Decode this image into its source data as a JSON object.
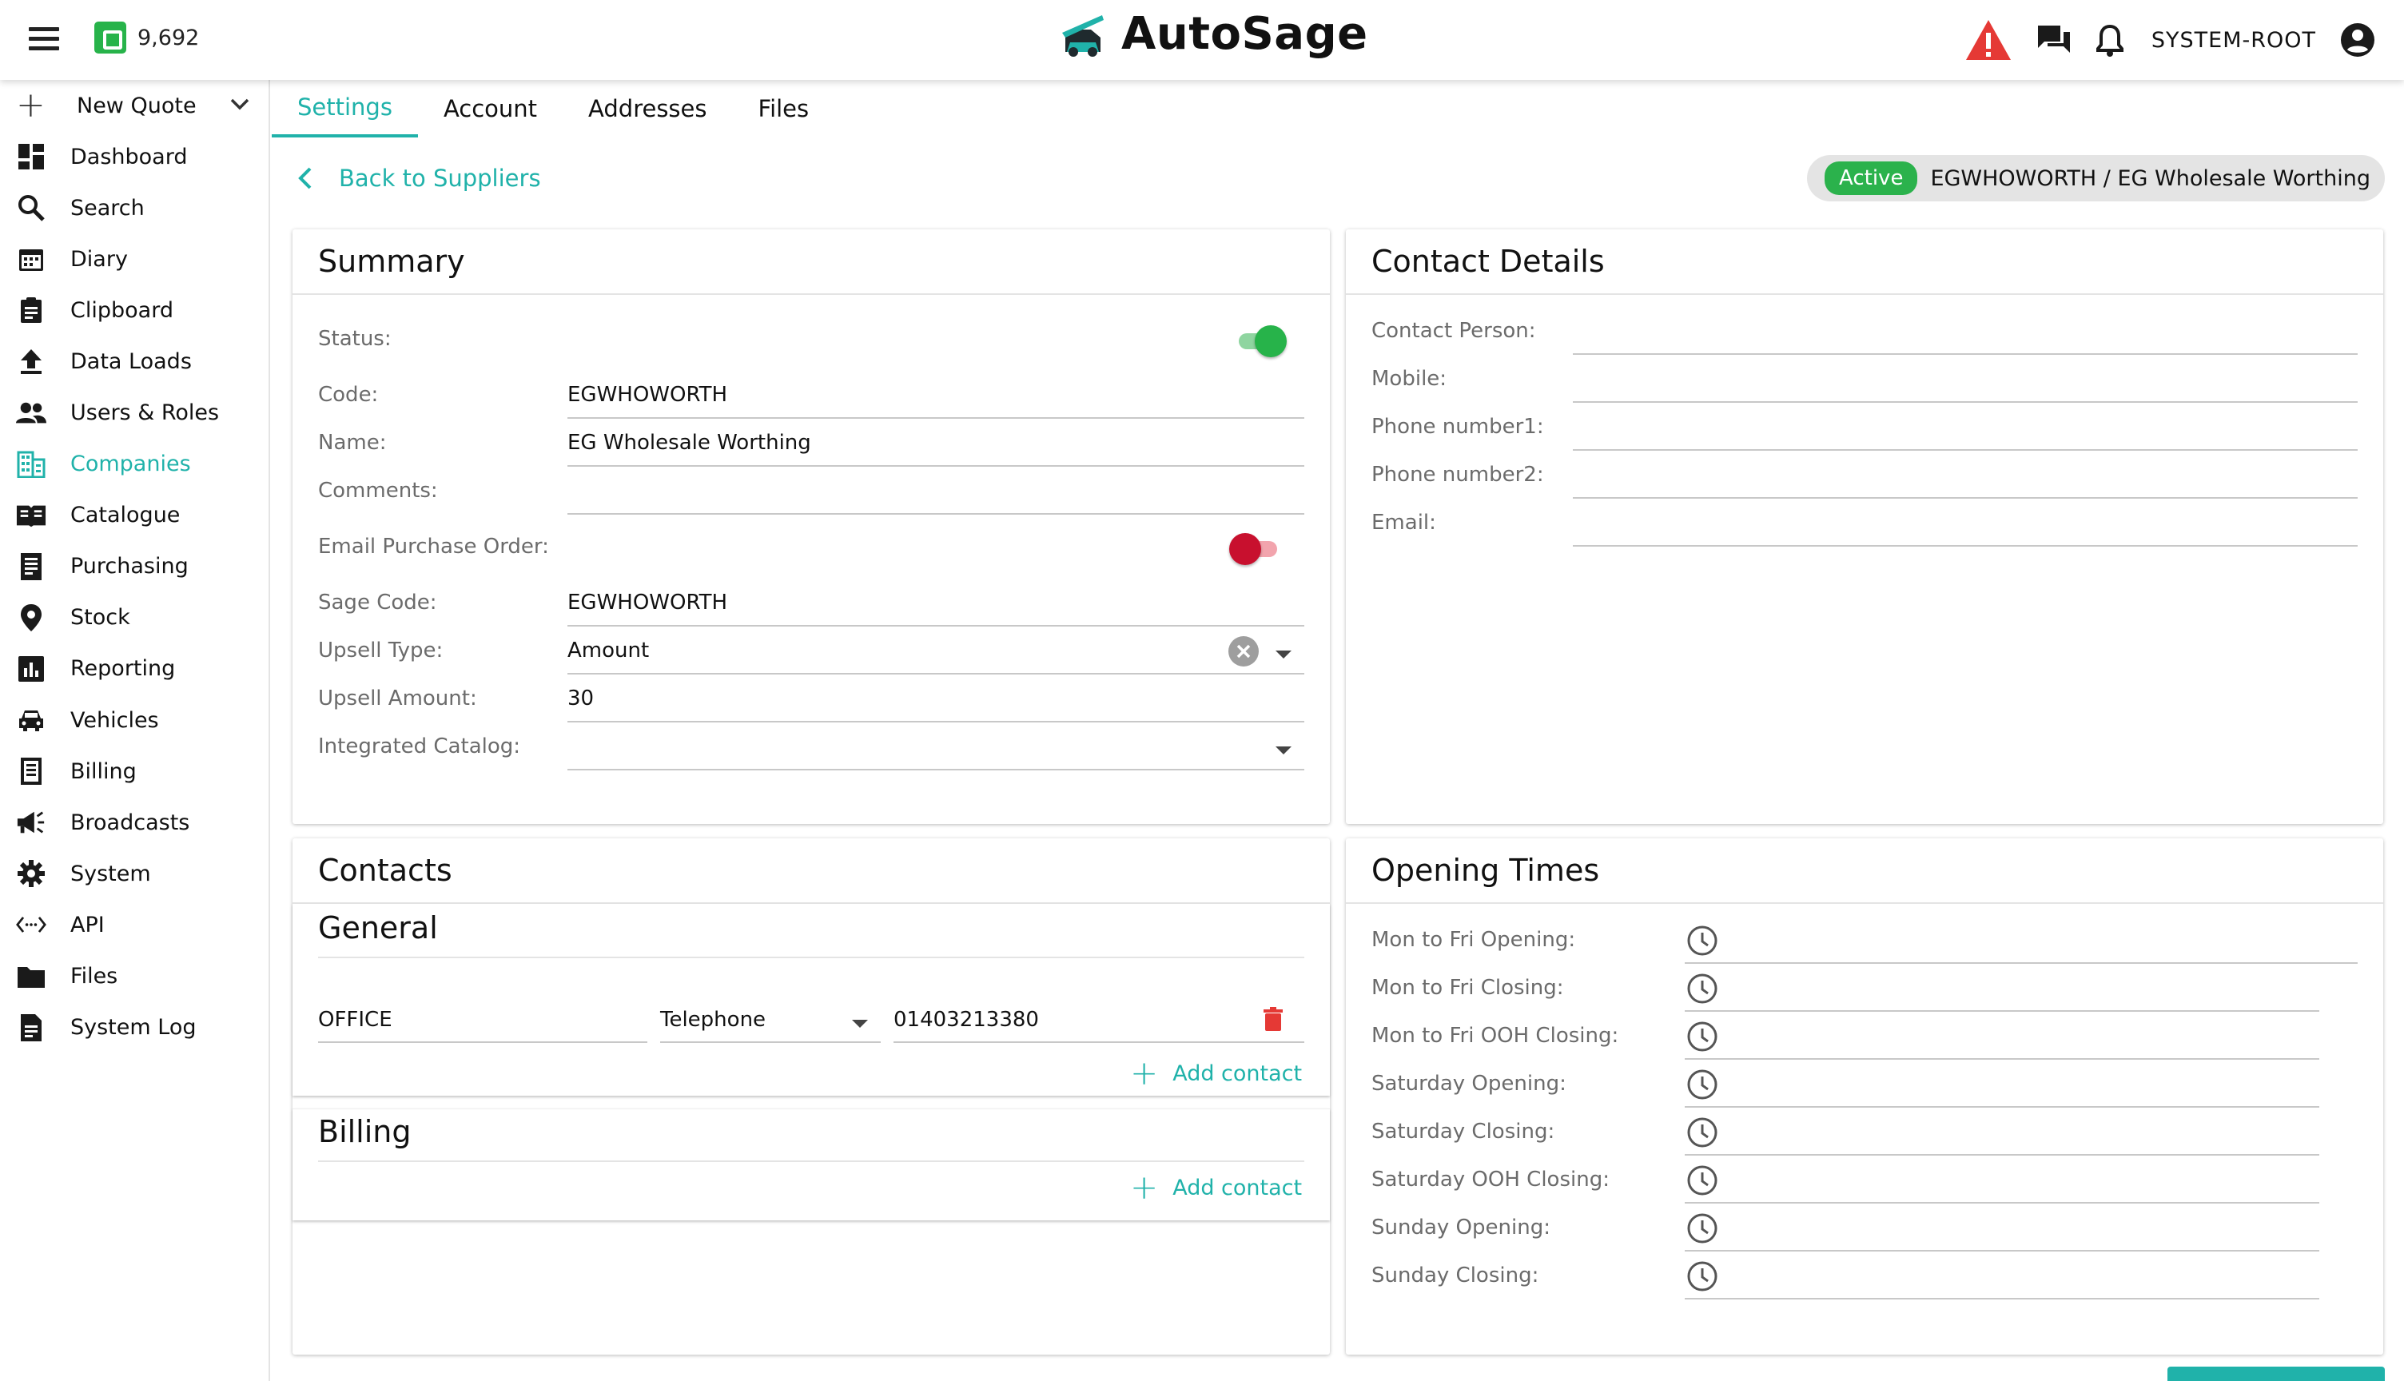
{
  "topbar": {
    "credit_value": "9,692",
    "app_name": "AutoSage",
    "user": "SYSTEM-ROOT",
    "colors": {
      "alert": "#e53935",
      "accent": "#20b2aa",
      "credit": "#27b34a"
    }
  },
  "sidebar": {
    "new_quote": "New Quote",
    "items": [
      {
        "label": "Dashboard",
        "icon": "dashboard-icon"
      },
      {
        "label": "Search",
        "icon": "search-icon"
      },
      {
        "label": "Diary",
        "icon": "calendar-icon"
      },
      {
        "label": "Clipboard",
        "icon": "clipboard-icon"
      },
      {
        "label": "Data Loads",
        "icon": "upload-icon"
      },
      {
        "label": "Users & Roles",
        "icon": "users-icon"
      },
      {
        "label": "Companies",
        "icon": "companies-icon",
        "active": true
      },
      {
        "label": "Catalogue",
        "icon": "book-icon"
      },
      {
        "label": "Purchasing",
        "icon": "receipt-icon"
      },
      {
        "label": "Stock",
        "icon": "location-pin-icon"
      },
      {
        "label": "Reporting",
        "icon": "report-chart-icon"
      },
      {
        "label": "Vehicles",
        "icon": "car-icon"
      },
      {
        "label": "Billing",
        "icon": "billing-icon"
      },
      {
        "label": "Broadcasts",
        "icon": "megaphone-icon"
      },
      {
        "label": "System",
        "icon": "gear-icon"
      },
      {
        "label": "API",
        "icon": "code-icon"
      },
      {
        "label": "Files",
        "icon": "folder-icon"
      },
      {
        "label": "System Log",
        "icon": "document-icon"
      }
    ]
  },
  "tabs": [
    "Settings",
    "Account",
    "Addresses",
    "Files"
  ],
  "active_tab": "Settings",
  "back_label": "Back to Suppliers",
  "status_chip": {
    "badge": "Active",
    "text": "EGWHOWORTH / EG Wholesale Worthing"
  },
  "summary": {
    "title": "Summary",
    "status_label": "Status:",
    "status_on": true,
    "code_label": "Code:",
    "code": "EGWHOWORTH",
    "name_label": "Name:",
    "name": "EG Wholesale Worthing",
    "comments_label": "Comments:",
    "comments": "",
    "email_po_label": "Email Purchase Order:",
    "email_po_on": false,
    "sage_code_label": "Sage Code:",
    "sage_code": "EGWHOWORTH",
    "upsell_type_label": "Upsell Type:",
    "upsell_type": "Amount",
    "upsell_amount_label": "Upsell Amount:",
    "upsell_amount": "30",
    "integrated_catalog_label": "Integrated Catalog:",
    "integrated_catalog": ""
  },
  "contact_details": {
    "title": "Contact Details",
    "fields": [
      {
        "label": "Contact Person:",
        "value": ""
      },
      {
        "label": "Mobile:",
        "value": ""
      },
      {
        "label": "Phone number1:",
        "value": ""
      },
      {
        "label": "Phone number2:",
        "value": ""
      },
      {
        "label": "Email:",
        "value": ""
      }
    ]
  },
  "contacts": {
    "title": "Contacts",
    "general_title": "General",
    "general_row": {
      "name": "OFFICE",
      "type": "Telephone",
      "value": "01403213380"
    },
    "add_contact": "Add contact",
    "billing_title": "Billing",
    "billing_add_contact": "Add contact"
  },
  "opening_times": {
    "title": "Opening Times",
    "fields": [
      {
        "label": "Mon to Fri Opening:",
        "value": ""
      },
      {
        "label": "Mon to Fri Closing:",
        "value": ""
      },
      {
        "label": "Mon to Fri OOH Closing:",
        "value": ""
      },
      {
        "label": "Saturday Opening:",
        "value": ""
      },
      {
        "label": "Saturday Closing:",
        "value": ""
      },
      {
        "label": "Saturday OOH Closing:",
        "value": ""
      },
      {
        "label": "Sunday Opening:",
        "value": ""
      },
      {
        "label": "Sunday Closing:",
        "value": ""
      }
    ]
  }
}
